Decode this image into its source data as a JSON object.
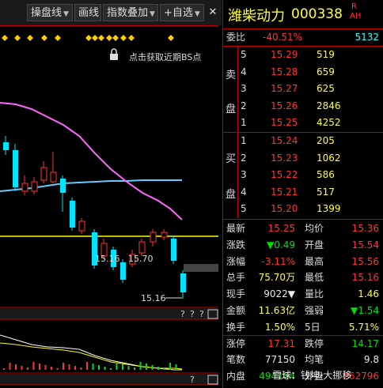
{
  "toolbar": {
    "items": [
      {
        "label": "操盘线",
        "has_dropdown": true
      },
      {
        "label": "画线",
        "has_dropdown": false
      },
      {
        "label": "指数叠加",
        "has_dropdown": true
      },
      {
        "label": "+自选",
        "has_dropdown": true
      }
    ],
    "close_symbol": "✕"
  },
  "chart": {
    "bs_hint": "点击获取近期BS点",
    "price_labels": [
      "15.16",
      "15.70",
      "15.16"
    ],
    "question_marks": [
      "?",
      "?",
      "?"
    ],
    "diamonds_count": 12,
    "colors": {
      "up": "#ff3333",
      "down": "#00e5ff",
      "ma": "#66ccff",
      "ma2": "#ff66ff",
      "level": "#ffff00"
    }
  },
  "stock": {
    "name": "潍柴动力",
    "code": "000338",
    "flags": [
      "R",
      "AH"
    ]
  },
  "commission": {
    "label": "委比",
    "ratio": "-40.51%",
    "diff": "5132"
  },
  "sell_side_label": [
    "卖",
    "盘"
  ],
  "buy_side_label": [
    "买",
    "盘"
  ],
  "asks": [
    {
      "level": "5",
      "price": "15.29",
      "volume": "519"
    },
    {
      "level": "4",
      "price": "15.28",
      "volume": "659"
    },
    {
      "level": "3",
      "price": "15.27",
      "volume": "625"
    },
    {
      "level": "2",
      "price": "15.26",
      "volume": "2846"
    },
    {
      "level": "1",
      "price": "15.25",
      "volume": "4252"
    }
  ],
  "bids": [
    {
      "level": "1",
      "price": "15.24",
      "volume": "205"
    },
    {
      "level": "2",
      "price": "15.23",
      "volume": "1062"
    },
    {
      "level": "3",
      "price": "15.22",
      "volume": "586"
    },
    {
      "level": "4",
      "price": "15.21",
      "volume": "517"
    },
    {
      "level": "5",
      "price": "15.20",
      "volume": "1399"
    }
  ],
  "quote": [
    {
      "l1": "最新",
      "v1": "15.25",
      "c1": "red",
      "l2": "均价",
      "v2": "15.36",
      "c2": "red"
    },
    {
      "l1": "涨跌",
      "v1": "▼0.49",
      "c1": "green",
      "l2": "开盘",
      "v2": "15.54",
      "c2": "red"
    },
    {
      "l1": "涨幅",
      "v1": "-3.11%",
      "c1": "red",
      "l2": "最高",
      "v2": "15.56",
      "c2": "red"
    },
    {
      "l1": "总手",
      "v1": "75.70万",
      "c1": "yellow",
      "l2": "最低",
      "v2": "15.16",
      "c2": "red"
    },
    {
      "l1": "现手",
      "v1": "9022▼",
      "c1": "white",
      "l2": "量比",
      "v2": "1.46",
      "c2": "yellow"
    },
    {
      "l1": "金额",
      "v1": "11.63亿",
      "c1": "yellow",
      "l2": "强弱",
      "v2": "▼1.54",
      "c2": "green"
    },
    {
      "l1": "换手",
      "v1": "1.50%",
      "c1": "yellow",
      "l2": "5日",
      "v2": "5.71%",
      "c2": "yellow"
    },
    {
      "l1": "涨停",
      "v1": "17.31",
      "c1": "red",
      "l2": "跌停",
      "v2": "14.17",
      "c2": "green"
    },
    {
      "l1": "笔数",
      "v1": "77150",
      "c1": "white",
      "l2": "均笔",
      "v2": "9.8",
      "c2": "white"
    },
    {
      "l1": "内盘",
      "v1": "494184",
      "c1": "green",
      "l2": "外盘",
      "v2": "262796",
      "c2": "red"
    }
  ],
  "watermark": "雪球：钱坤-大挪移"
}
